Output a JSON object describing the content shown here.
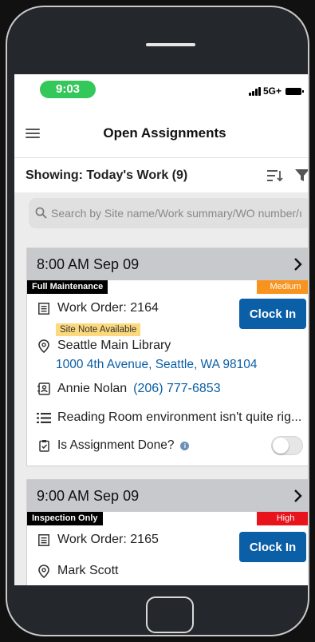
{
  "status_bar": {
    "time": "9:03",
    "network": "5G+"
  },
  "nav": {
    "title": "Open Assignments"
  },
  "filter_bar": {
    "showing": "Showing: Today's Work (9)"
  },
  "search": {
    "placeholder": "Search by Site name/Work summary/WO number/ı"
  },
  "assignments": [
    {
      "time": "8:00 AM Sep 09",
      "type": "Full Maintenance",
      "priority": "Medium",
      "priority_color": "#f7931e",
      "work_order": "Work Order: 2164",
      "clock_in": "Clock In",
      "site_note": "Site Note Available",
      "site_name": "Seattle Main Library",
      "address": "1000 4th Avenue, Seattle, WA 98104",
      "contact_name": "Annie Nolan",
      "contact_phone": "(206) 777-6853",
      "summary": "Reading Room environment isn't quite rig...",
      "done_label": "Is Assignment Done?",
      "done": false
    },
    {
      "time": "9:00 AM Sep 09",
      "type": "Inspection Only",
      "priority": "High",
      "priority_color": "#e8131b",
      "work_order": "Work Order: 2165",
      "clock_in": "Clock In",
      "contact_name": "Mark Scott"
    }
  ]
}
